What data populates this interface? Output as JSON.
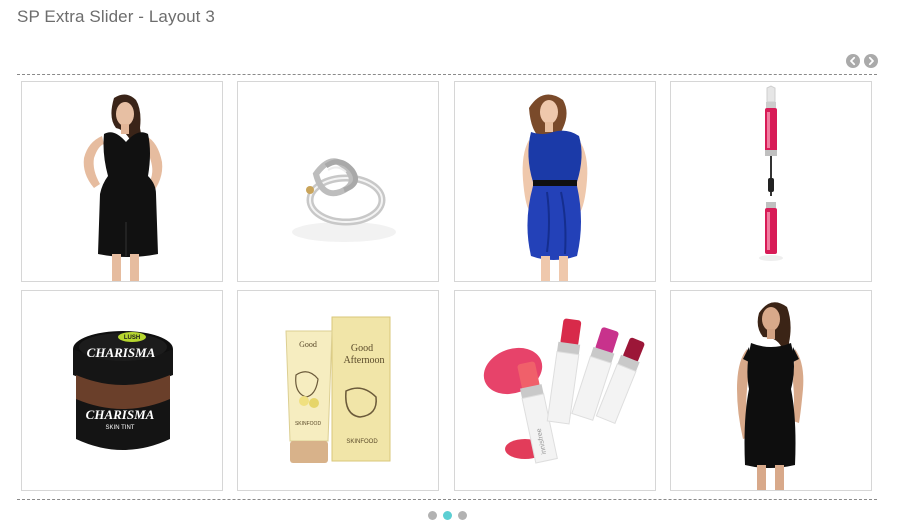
{
  "header": {
    "title": "SP Extra Slider - Layout 3"
  },
  "nav": {
    "prev_icon": "chevron-left-icon",
    "next_icon": "chevron-right-icon"
  },
  "items": [
    {
      "name": "product-black-peplum-dress",
      "icon": "dress-photo"
    },
    {
      "name": "product-silver-knot-ring",
      "icon": "ring-photo"
    },
    {
      "name": "product-blue-draped-dress",
      "icon": "dress-photo"
    },
    {
      "name": "product-pink-mascara",
      "icon": "mascara-photo"
    },
    {
      "name": "product-charisma-skin-tint",
      "icon": "jar-photo"
    },
    {
      "name": "product-good-afternoon-cream",
      "icon": "tube-photo"
    },
    {
      "name": "product-lipstick-set",
      "icon": "lipstick-photo"
    },
    {
      "name": "product-black-cold-shoulder-dress",
      "icon": "dress-photo"
    }
  ],
  "labels": {
    "lush_badge": "LUSH",
    "charisma": "CHARISMA",
    "skin_tint": "SKIN TINT",
    "good_afternoon_1": "Good",
    "good_afternoon_2": "Afternoon",
    "skinfood": "SKINFOOD",
    "innisfree": "innisfree"
  },
  "pagination": {
    "count": 3,
    "active_index": 1
  },
  "colors": {
    "accent": "#5ccfd3",
    "dot": "#b2b2b2",
    "nav": "#aaaaaa",
    "border": "#d6d6d6"
  }
}
